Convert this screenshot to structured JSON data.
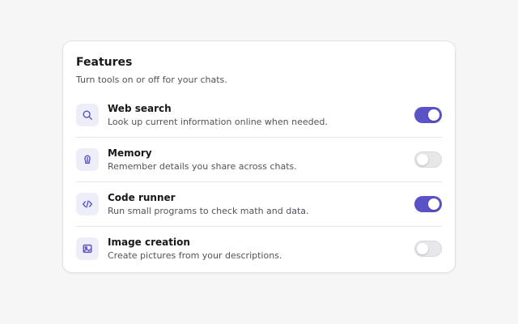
{
  "card": {
    "title": "Features",
    "subtitle": "Turn tools on or off for your chats."
  },
  "features": [
    {
      "name": "Web search",
      "description": "Look up current information online when needed.",
      "icon": "search-icon",
      "enabled": true
    },
    {
      "name": "Memory",
      "description": "Remember details you share across chats.",
      "icon": "memory-icon",
      "enabled": false
    },
    {
      "name": "Code runner",
      "description": "Run small programs to check math and data.",
      "icon": "code-icon",
      "enabled": true
    },
    {
      "name": "Image creation",
      "description": "Create pictures from your descriptions.",
      "icon": "image-icon",
      "enabled": false
    }
  ],
  "colors": {
    "accent": "#5a52c7",
    "toggle_off": "#e7e7ea"
  }
}
